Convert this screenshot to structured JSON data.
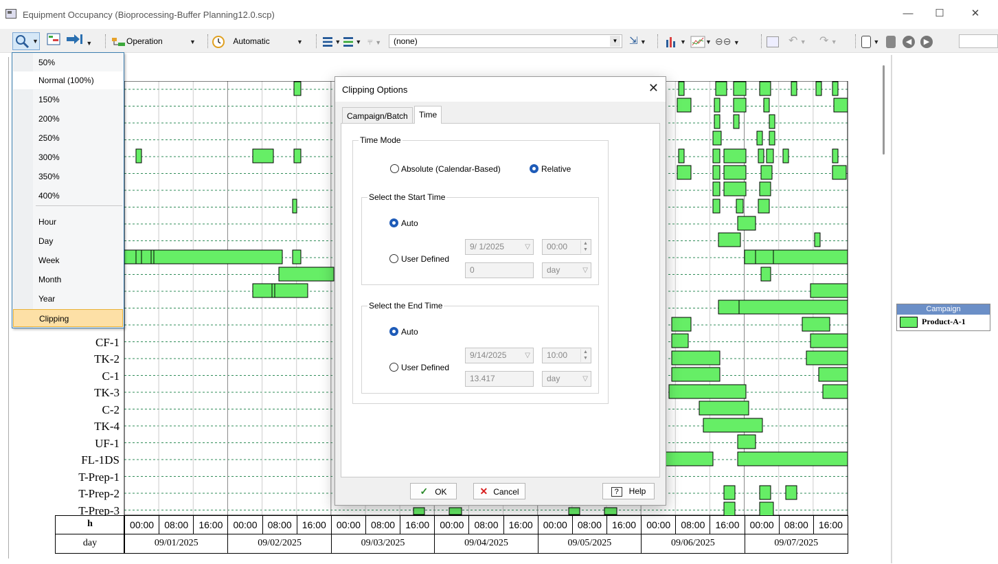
{
  "window": {
    "title": "Equipment Occupancy (Bioprocessing-Buffer Planning12.0.scp)",
    "controls": [
      "—",
      "☐",
      "✕"
    ]
  },
  "toolbar": {
    "operation_label": "Operation",
    "automatic_label": "Automatic",
    "filter_value": "(none)"
  },
  "zoom_menu": {
    "items": [
      "50%",
      "Normal (100%)",
      "150%",
      "200%",
      "250%",
      "300%",
      "350%",
      "400%",
      "Hour",
      "Day",
      "Week",
      "Month",
      "Year",
      "Clipping"
    ],
    "checked": "Normal (100%)",
    "highlighted": "Clipping",
    "check_glyph": "✓"
  },
  "gantt": {
    "row_labels": [
      "CF-1",
      "TK-2",
      "C-1",
      "TK-3",
      "C-2",
      "TK-4",
      "UF-1",
      "FL-1DS",
      "T-Prep-1",
      "T-Prep-2",
      "T-Prep-3"
    ],
    "hour_axis_label": "h",
    "day_axis_label": "day",
    "hour_ticks": [
      "00:00",
      "08:00",
      "16:00",
      "00:00",
      "08:00",
      "16:00",
      "00:00",
      "08:00",
      "16:00",
      "00:00",
      "08:00",
      "16:00",
      "00:00",
      "08:00",
      "16:00",
      "00:00",
      "08:00",
      "16:00",
      "00:00",
      "08:00",
      "16:00"
    ],
    "days": [
      "09/01/2025",
      "09/02/2025",
      "09/03/2025",
      "09/04/2025",
      "09/05/2025",
      "09/06/2025",
      "09/07/2025"
    ],
    "bar_color": "#66ee66"
  },
  "legend": {
    "header": "Campaign",
    "items": [
      {
        "label": "Product-A-1",
        "color": "#66ee66"
      }
    ]
  },
  "dialog": {
    "title": "Clipping Options",
    "close_glyph": "✕",
    "tabs": [
      "Campaign/Batch",
      "Time"
    ],
    "active_tab": "Time",
    "time_mode": {
      "title": "Time Mode",
      "absolute_label": "Absolute (Calendar-Based)",
      "relative_label": "Relative",
      "selected": "Relative"
    },
    "start": {
      "title": "Select the Start Time",
      "auto_label": "Auto",
      "user_label": "User Defined",
      "selected": "Auto",
      "date": "9/ 1/2025",
      "time": "00:00",
      "offset": "0",
      "unit": "day"
    },
    "end": {
      "title": "Select the End Time",
      "auto_label": "Auto",
      "user_label": "User Defined",
      "selected": "Auto",
      "date": "9/14/2025",
      "time": "10:00",
      "offset": "13.417",
      "unit": "day"
    },
    "buttons": {
      "ok": "OK",
      "cancel": "Cancel",
      "help": "Help",
      "ok_glyph": "✓",
      "cancel_glyph": "✕",
      "help_glyph": "?"
    }
  }
}
